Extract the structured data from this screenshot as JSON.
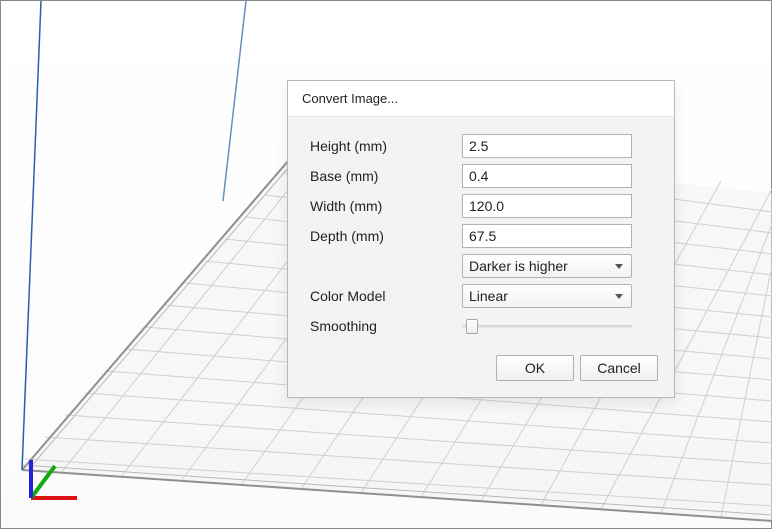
{
  "dialog": {
    "title": "Convert Image...",
    "height_label": "Height (mm)",
    "height_value": "2.5",
    "base_label": "Base (mm)",
    "base_value": "0.4",
    "width_label": "Width (mm)",
    "width_value": "120.0",
    "depth_label": "Depth (mm)",
    "depth_value": "67.5",
    "mapping_value": "Darker is higher",
    "color_model_label": "Color Model",
    "color_model_value": "Linear",
    "smoothing_label": "Smoothing",
    "ok_label": "OK",
    "cancel_label": "Cancel"
  }
}
